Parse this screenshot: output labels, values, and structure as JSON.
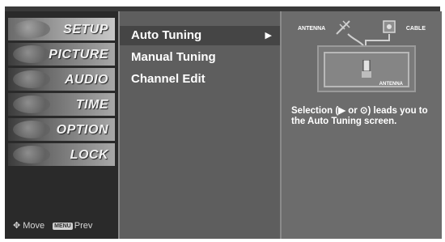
{
  "nav": {
    "items": [
      {
        "label": "SETUP"
      },
      {
        "label": "PICTURE"
      },
      {
        "label": "AUDIO"
      },
      {
        "label": "TIME"
      },
      {
        "label": "OPTION"
      },
      {
        "label": "LOCK"
      }
    ],
    "footer": {
      "move_icon": "four-way-arrow-icon",
      "move_label": "Move",
      "menu_key": "MENU",
      "prev_label": "Prev"
    }
  },
  "submenu": {
    "items": [
      {
        "label": "Auto Tuning",
        "selected": true
      },
      {
        "label": "Manual Tuning",
        "selected": false
      },
      {
        "label": "Channel Edit",
        "selected": false
      }
    ],
    "arrow": "▶"
  },
  "panel": {
    "antenna_label": "ANTENNA",
    "cable_label": "CABLE",
    "tv_antenna_label": "ANTENNA",
    "help_text": "Selection (▶ or ⊙) leads you to the Auto Tuning screen."
  },
  "colors": {
    "panel_bg": "#5a5a5a",
    "selected_bg": "#454545",
    "text": "#ffffff"
  }
}
